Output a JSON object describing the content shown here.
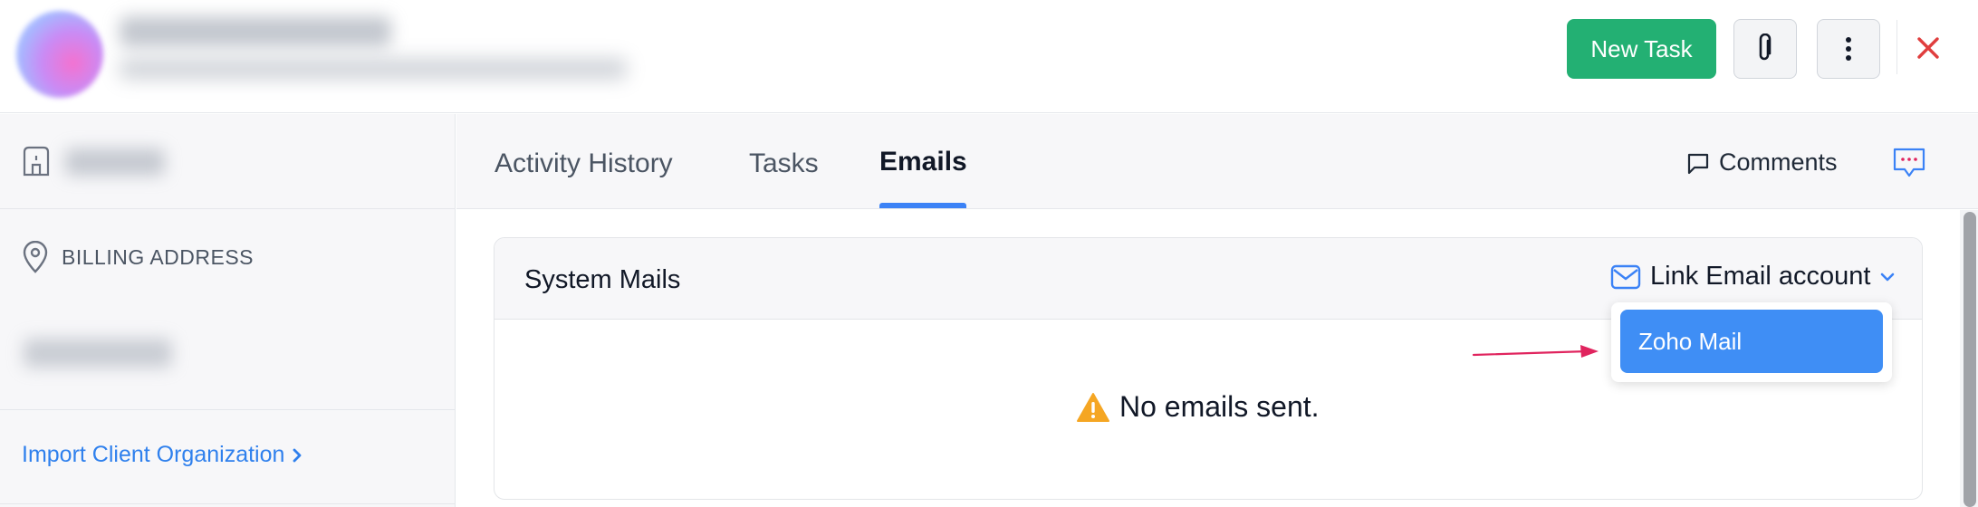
{
  "header": {
    "new_task_label": "New Task",
    "attach_icon": "paperclip-icon",
    "more_icon": "vertical-dots-icon",
    "close_icon": "close-icon"
  },
  "sidebar": {
    "building_icon": "building-icon",
    "billing_address_label": "BILLING ADDRESS",
    "import_link_label": "Import Client Organization"
  },
  "tabs": [
    {
      "label": "Activity History",
      "active": false
    },
    {
      "label": "Tasks",
      "active": false
    },
    {
      "label": "Emails",
      "active": true
    }
  ],
  "toolbar": {
    "comments_label": "Comments"
  },
  "main": {
    "card_title": "System Mails",
    "link_email_label": "Link Email account",
    "empty_message": "No emails sent."
  },
  "dropdown": {
    "options": [
      "Zoho Mail"
    ],
    "highlighted": "Zoho Mail"
  },
  "colors": {
    "primary_green": "#23b073",
    "accent_blue": "#3b82f6",
    "link_blue": "#2f80ed",
    "close_red": "#e03e3e",
    "warning_yellow": "#f5a623",
    "annotation_arrow": "#e0245e"
  }
}
